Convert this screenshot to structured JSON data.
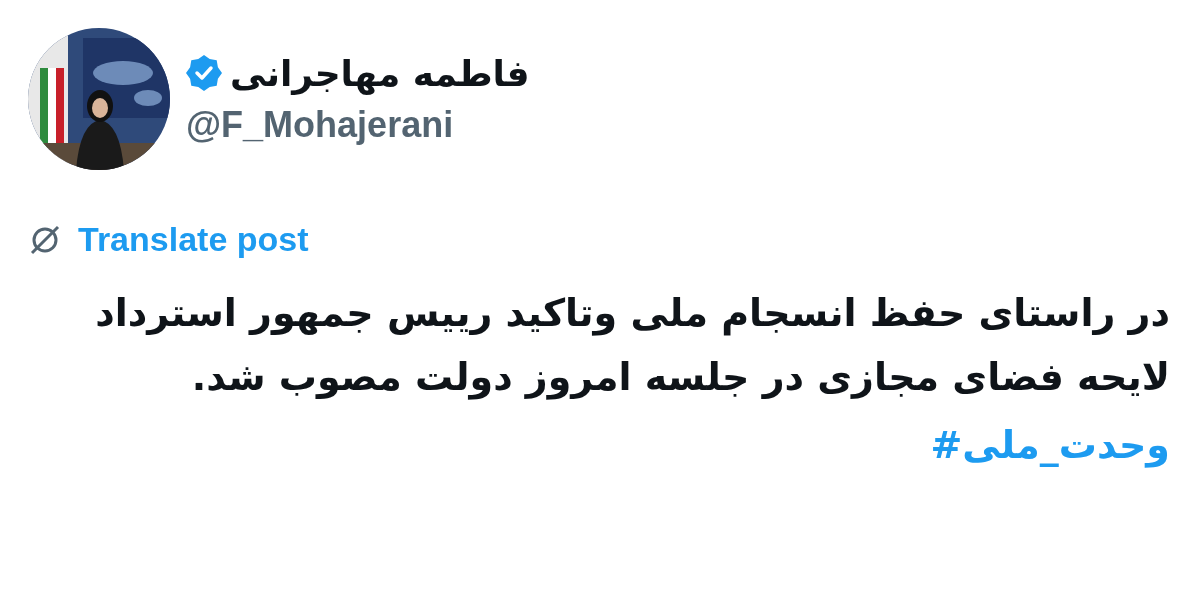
{
  "author": {
    "name": "فاطمه مهاجرانی",
    "verified": true,
    "handle": "@F_Mohajerani"
  },
  "translate_link": "Translate post",
  "post_text": "در راستای حفظ انسجام ملی وتاکید رییس جمهور استرداد لایحه فضای مجازی در جلسه امروز دولت مصوب شد.",
  "hashtag": "#وحدت_ملی"
}
